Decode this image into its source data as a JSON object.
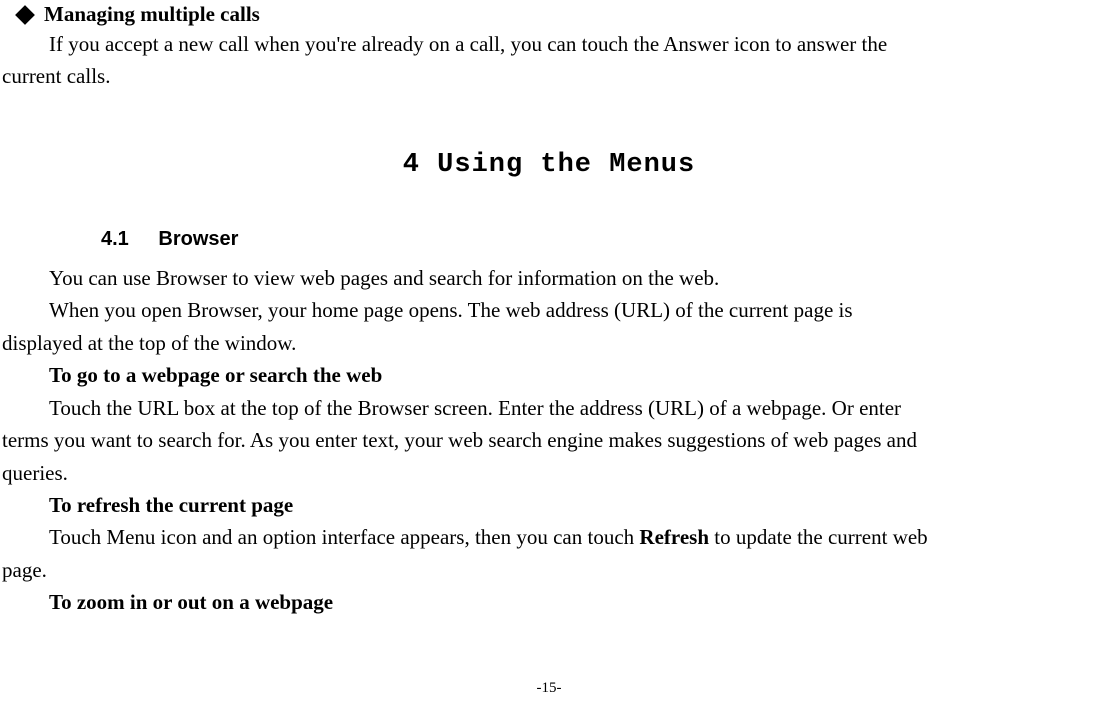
{
  "bullet1": {
    "title": "Managing multiple calls"
  },
  "p1a": "If you accept a new call when you're already on a call, you can touch the Answer icon to answer the",
  "p1b": "current calls.",
  "chapter_heading": "4 Using the Menus",
  "section": {
    "num": "4.1",
    "title": "Browser"
  },
  "p2": "You can use Browser to view web pages and search for information on the web.",
  "p3a": "When you open Browser, your home page opens. The web address (URL) of the current page is",
  "p3b": "displayed at the top of the window.",
  "h1": "To go to a webpage or search the web",
  "p4a": "Touch the URL box at the top of the Browser screen. Enter the address (URL) of a webpage. Or enter",
  "p4b": "terms you want to search for. As you enter text, your web search engine makes suggestions of web pages and",
  "p4c": "queries.",
  "h2": "To refresh the current page",
  "p5a_pre": "Touch Menu icon and an option interface appears, then you can touch ",
  "p5a_bold": "Refresh",
  "p5a_post": " to update the current web",
  "p5b": "page.",
  "h3": "To zoom in or out on a webpage",
  "footer": "-15-"
}
